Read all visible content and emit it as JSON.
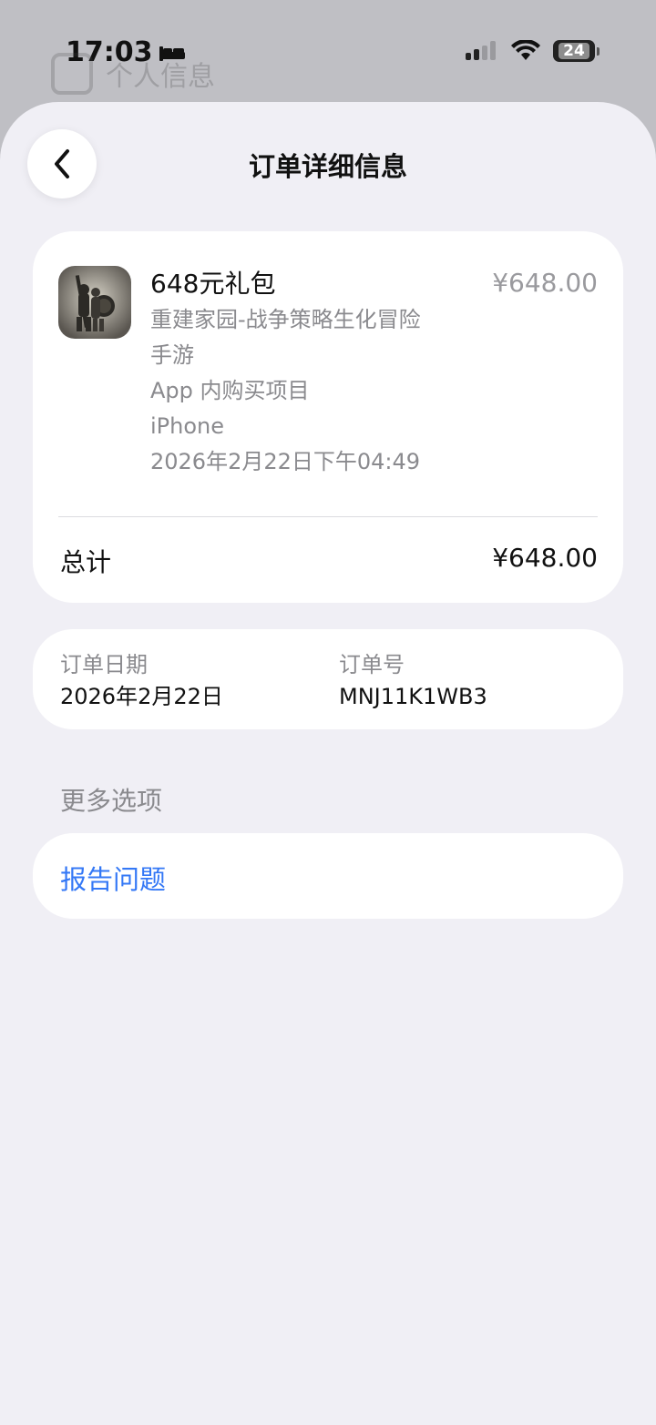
{
  "status_bar": {
    "time": "17:03",
    "battery": "24",
    "icons": [
      "bed-icon",
      "signal-icon",
      "wifi-icon",
      "battery-icon"
    ]
  },
  "background_page": {
    "title": "个人信息"
  },
  "header": {
    "title": "订单详细信息",
    "back_icon": "chevron-left-icon"
  },
  "item": {
    "name": "648元礼包",
    "price": "¥648.00",
    "app_name_line1": "重建家园-战争策略生化冒险",
    "app_name_line2": "手游",
    "type": "App 内购买项目",
    "device": "iPhone",
    "datetime": "2026年2月22日下午04:49"
  },
  "total": {
    "label": "总计",
    "value": "¥648.00"
  },
  "order": {
    "date_label": "订单日期",
    "date_value": "2026年2月22日",
    "number_label": "订单号",
    "number_value": "MNJ11K1WB3"
  },
  "more_options": {
    "title": "更多选项",
    "report_label": "报告问题"
  },
  "colors": {
    "accent": "#3478f6",
    "sheet_bg": "#f0eff5",
    "card_bg": "#ffffff",
    "secondary_text": "#8a8a8e"
  }
}
